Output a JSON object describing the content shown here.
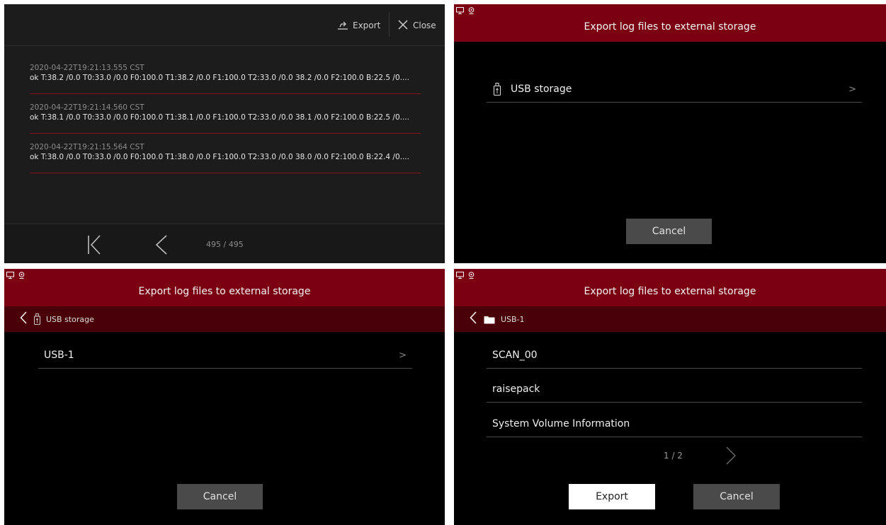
{
  "panel1": {
    "export_label": "Export",
    "close_label": "Close",
    "logs": [
      {
        "timestamp": "2020-04-22T19:21:13.555 CST",
        "message": "ok T:38.2 /0.0 T0:33.0 /0.0 F0:100.0 T1:38.2 /0.0 F1:100.0 T2:33.0 /0.0 38.2 /0.0 F2:100.0 B:22.5 /0...."
      },
      {
        "timestamp": "2020-04-22T19:21:14.560 CST",
        "message": "ok T:38.1 /0.0 T0:33.0 /0.0 F0:100.0 T1:38.1 /0.0 F1:100.0 T2:33.0 /0.0 38.1 /0.0 F2:100.0 B:22.5 /0...."
      },
      {
        "timestamp": "2020-04-22T19:21:15.564 CST",
        "message": "ok T:38.0 /0.0 T0:33.0 /0.0 F0:100.0 T1:38.0 /0.0 F1:100.0 T2:33.0 /0.0 38.0 /0.0 F2:100.0 B:22.4 /0...."
      }
    ],
    "page_indicator": "495 / 495"
  },
  "panel2": {
    "title": "Export log files to external storage",
    "items": [
      {
        "label": "USB storage",
        "chevron": ">"
      }
    ],
    "cancel_label": "Cancel"
  },
  "panel3": {
    "title": "Export log files to external storage",
    "breadcrumb": "USB storage",
    "items": [
      {
        "label": "USB-1",
        "chevron": ">"
      }
    ],
    "cancel_label": "Cancel"
  },
  "panel4": {
    "title": "Export log files to external storage",
    "breadcrumb": "USB-1",
    "items": [
      {
        "label": "SCAN_00"
      },
      {
        "label": "raisepack"
      },
      {
        "label": "System Volume Information"
      }
    ],
    "page_indicator": "1 / 2",
    "export_label": "Export",
    "cancel_label": "Cancel"
  },
  "colors": {
    "header_red": "#7a0012",
    "breadcrumb_red": "#4a0009",
    "log_divider": "#8a1020"
  },
  "icons": [
    "export-icon",
    "close-icon",
    "first-page-icon",
    "prev-page-icon",
    "monitor-icon",
    "webcam-icon",
    "usb-drive-icon",
    "folder-icon",
    "back-arrow-icon",
    "next-page-icon"
  ]
}
